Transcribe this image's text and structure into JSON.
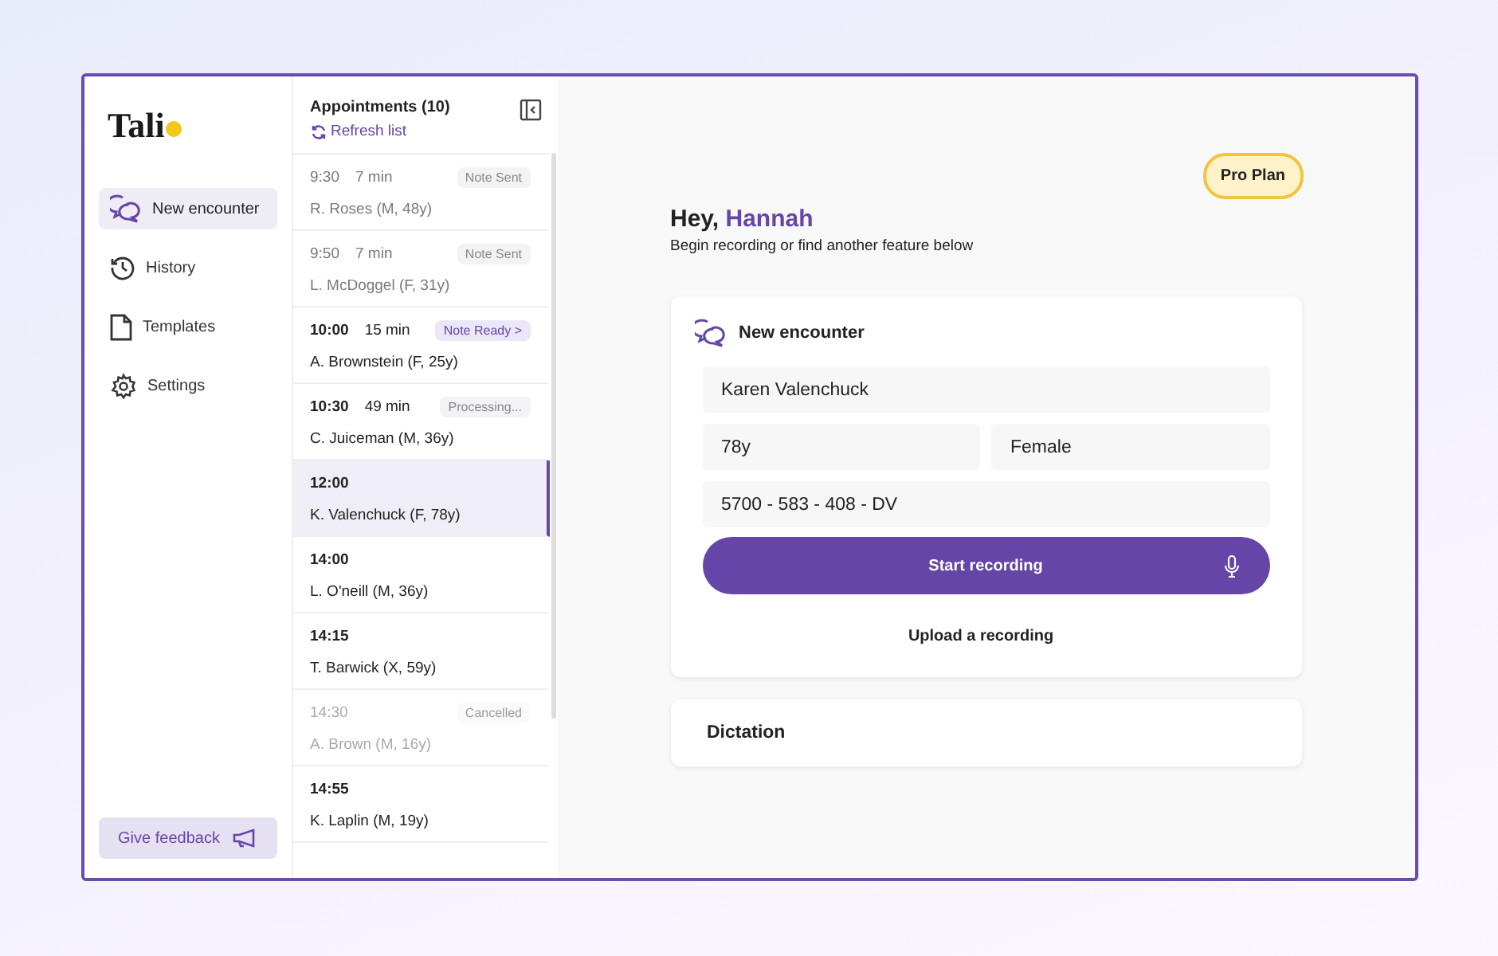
{
  "sidebar": {
    "logo": "Tali",
    "items": [
      {
        "label": "New encounter",
        "selected": true
      },
      {
        "label": "History",
        "selected": false
      },
      {
        "label": "Templates",
        "selected": false
      },
      {
        "label": "Settings",
        "selected": false
      }
    ],
    "feedback_button": "Give feedback"
  },
  "appointments": {
    "title": "Appointments (10)",
    "refresh": "Refresh list",
    "rows": [
      {
        "time": "9:30",
        "duration": "7 min",
        "patient": "R. Roses (M, 48y)",
        "kind": "sent",
        "badge": "Note Sent",
        "selected": false
      },
      {
        "time": "9:50",
        "duration": "7 min",
        "patient": "L. McDoggel (F, 31y)",
        "kind": "sent",
        "badge": "Note Sent",
        "selected": false
      },
      {
        "time": "10:00",
        "duration": "15 min",
        "patient": "A. Brownstein (F, 25y)",
        "kind": "ready",
        "badge": "Note Ready >",
        "selected": false
      },
      {
        "time": "10:30",
        "duration": "49 min",
        "patient": "C. Juiceman (M, 36y)",
        "kind": "processing",
        "badge": "Processing...",
        "selected": false
      },
      {
        "time": "12:00",
        "patient": "K. Valenchuck (F, 78y)",
        "kind": "upcoming",
        "selected": true
      },
      {
        "time": "14:00",
        "patient": "L. O'neill (M, 36y)",
        "kind": "upcoming",
        "selected": false
      },
      {
        "time": "14:15",
        "patient": "T. Barwick (X, 59y)",
        "kind": "upcoming",
        "selected": false
      },
      {
        "time": "14:30",
        "patient": "A. Brown (M, 16y)",
        "kind": "cancelled",
        "badge": "Cancelled",
        "selected": false
      },
      {
        "time": "14:55",
        "patient": "K. Laplin (M, 19y)",
        "kind": "upcoming",
        "selected": false
      }
    ]
  },
  "main": {
    "plan": "Pro Plan",
    "greeting": "Hey,",
    "name": "Hannah",
    "subtitle": "Begin recording or find another feature below",
    "encounter": {
      "title": "New encounter",
      "patient_name": "Karen Valenchuck",
      "age": "78y",
      "sex": "Female",
      "nhs_number": "5700 - 583 - 408 - DV",
      "start_button": "Start recording",
      "upload_link": "Upload a recording"
    },
    "dictation": "Dictation"
  }
}
